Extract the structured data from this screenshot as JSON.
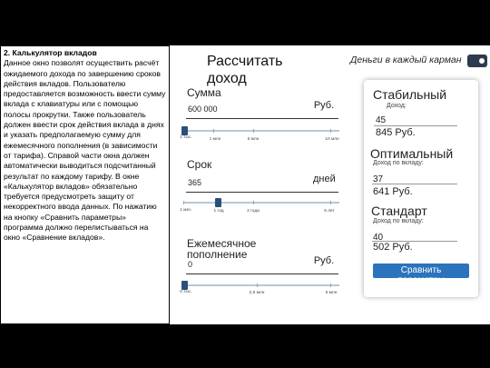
{
  "description": {
    "title": "2. Калькулятор вкладов",
    "body": "Данное окно позволят осуществить расчёт ожидаемого дохода по завершению сроков действия вкладов. Пользователю предоставляется возможность ввести сумму вклада с клавиатуры или с помощью полосы прокрутки. Также пользователь должен ввести срок действия вклада в днях и указать предполагаемую сумму для ежемесячного пополнения (в зависимости от тарифа). Справой части окна должен автоматически выводиться подсчитанный результат по каждому тарифу. В окне «Калькулятор вкладов» обязательно требуется предусмотреть защиту от некорректного ввода данных. По нажатию на кнопку «Сравнить параметры» программа должно перелистываться на окно «Сравнение вкладов»."
  },
  "header": {
    "title": "Рассчитать доход",
    "slogan": "Деньги в каждый карман",
    "wallet_icon": "wallet-icon"
  },
  "calculator": {
    "sum": {
      "label": "Сумма",
      "value": "600 000",
      "unit": "Руб.",
      "ticks": [
        "1 тыс.",
        "1 млн",
        "5 млн",
        "10 млн"
      ]
    },
    "term": {
      "label": "Срок",
      "value": "365",
      "unit": "дней",
      "ticks": [
        "1 мес.",
        "1 год",
        "2 года",
        "5 лет"
      ]
    },
    "monthly": {
      "label": "Ежемесячное пополнение",
      "value": "0",
      "unit": "Руб.",
      "ticks": [
        "0 тыс.",
        "2,5 млн",
        "5 млн"
      ]
    }
  },
  "results": {
    "stable": {
      "title": "Стабильный",
      "caption": "Доход:",
      "amount": "45",
      "rub": "845 Руб."
    },
    "optimal": {
      "title": "Оптимальный",
      "caption": "Доход по вкладу:",
      "amount": "37",
      "rub": "641 Руб."
    },
    "standard": {
      "title": "Стандарт",
      "caption": "Доход по вкладу:",
      "amount": "40",
      "rub": "502 Руб."
    },
    "compare_label": "Сравнить параметры"
  },
  "colors": {
    "accent": "#2b73bd",
    "slider_knob": "#2a4f7a",
    "background": "#000000"
  }
}
